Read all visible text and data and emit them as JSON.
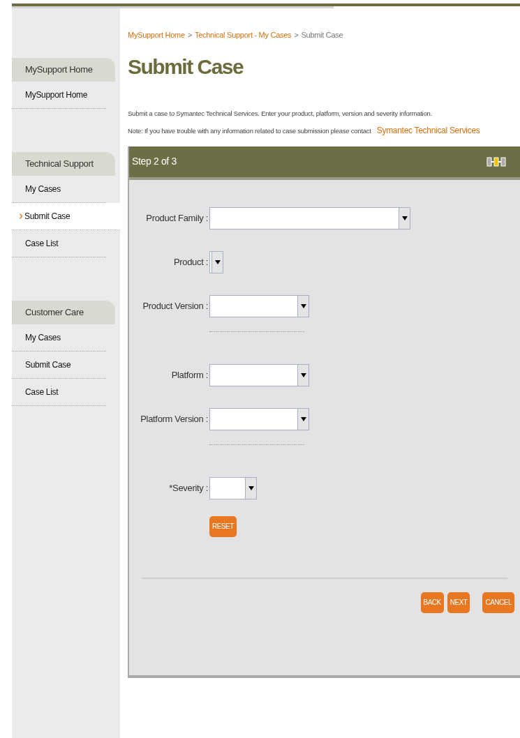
{
  "sidebar": {
    "sections": [
      {
        "title": "MySupport Home",
        "items": [
          {
            "label": "MySupport Home",
            "selected": false
          }
        ]
      },
      {
        "title": "Technical Support",
        "items": [
          {
            "label": "My Cases",
            "selected": false
          },
          {
            "label": "Submit Case",
            "selected": true
          },
          {
            "label": "Case List",
            "selected": false
          }
        ]
      },
      {
        "title": "Customer Care",
        "items": [
          {
            "label": "My Cases",
            "selected": false
          },
          {
            "label": "Submit Case",
            "selected": false
          },
          {
            "label": "Case List",
            "selected": false
          }
        ]
      }
    ]
  },
  "breadcrumb": [
    {
      "label": "MySupport Home",
      "link": true
    },
    {
      "label": ">",
      "link": false
    },
    {
      "label": "Technical Support - My Cases",
      "link": true
    },
    {
      "label": ">",
      "link": false
    },
    {
      "label": "Submit Case",
      "link": false
    }
  ],
  "title": "Submit Case",
  "intro": "Submit a case to Symantec Technical Services. Enter your product, platform, version and severity information.",
  "note": {
    "text": "Note: If you have trouble with any information related to case submission please contact",
    "link": "Symantec Technical Services"
  },
  "panel": {
    "step": "Step 2 of 3",
    "rows": [
      {
        "kind": "select",
        "label": "Product Family :"
      },
      {
        "kind": "select",
        "label": "Product :"
      },
      {
        "kind": "select",
        "label": "Product Version :"
      },
      {
        "kind": "separator"
      },
      {
        "kind": "select",
        "label": "Platform :"
      },
      {
        "kind": "select",
        "label": "Platform Version :"
      },
      {
        "kind": "separator"
      },
      {
        "kind": "select",
        "label": "*Severity :"
      },
      {
        "kind": "button",
        "label": "RESET"
      }
    ],
    "buttons": [
      "BACK",
      "NEXT",
      "CANCEL"
    ]
  }
}
